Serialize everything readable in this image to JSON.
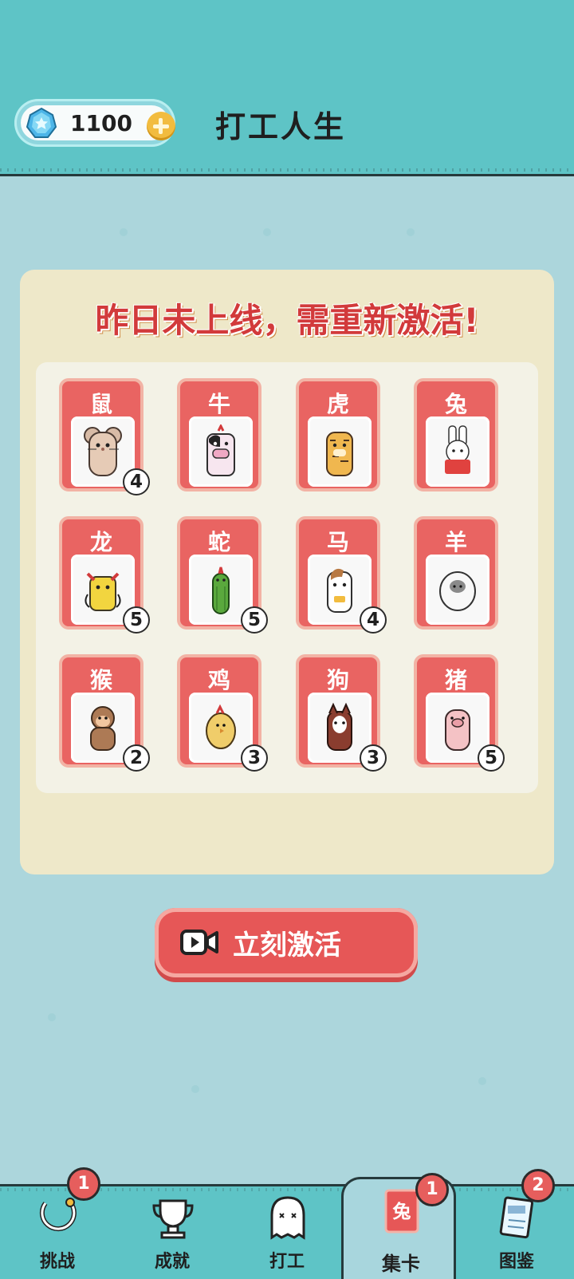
{
  "header": {
    "title": "打工人生",
    "currency_value": "1100",
    "gem_icon": "gem-icon",
    "plus_icon": "plus-icon"
  },
  "panel": {
    "title": "昨日未上线，需重新激活!",
    "cards": [
      {
        "label": "鼠",
        "badge": "4",
        "icon": "rat-icon"
      },
      {
        "label": "牛",
        "badge": "",
        "icon": "cow-icon"
      },
      {
        "label": "虎",
        "badge": "",
        "icon": "tiger-icon"
      },
      {
        "label": "兔",
        "badge": "",
        "icon": "rabbit-icon"
      },
      {
        "label": "龙",
        "badge": "5",
        "icon": "dragon-icon"
      },
      {
        "label": "蛇",
        "badge": "5",
        "icon": "snake-icon"
      },
      {
        "label": "马",
        "badge": "4",
        "icon": "horse-icon"
      },
      {
        "label": "羊",
        "badge": "",
        "icon": "sheep-icon"
      },
      {
        "label": "猴",
        "badge": "2",
        "icon": "monkey-icon"
      },
      {
        "label": "鸡",
        "badge": "3",
        "icon": "chicken-icon"
      },
      {
        "label": "狗",
        "badge": "3",
        "icon": "dog-icon"
      },
      {
        "label": "猪",
        "badge": "5",
        "icon": "pig-icon"
      }
    ]
  },
  "action": {
    "label": "立刻激活",
    "icon": "video-icon"
  },
  "bottom_nav": [
    {
      "label": "挑战",
      "badge": "1",
      "icon": "challenge-icon"
    },
    {
      "label": "成就",
      "badge": "",
      "icon": "trophy-icon"
    },
    {
      "label": "打工",
      "badge": "",
      "icon": "ghost-icon"
    },
    {
      "label": "集卡",
      "badge": "1",
      "icon": "card-icon",
      "active": true,
      "card_char": "兔"
    },
    {
      "label": "图鉴",
      "badge": "2",
      "icon": "book-icon"
    }
  ],
  "colors": {
    "teal": "#5ec4c6",
    "background": "#acd6dc",
    "red": "#e65757",
    "panel": "#eee8c9"
  }
}
